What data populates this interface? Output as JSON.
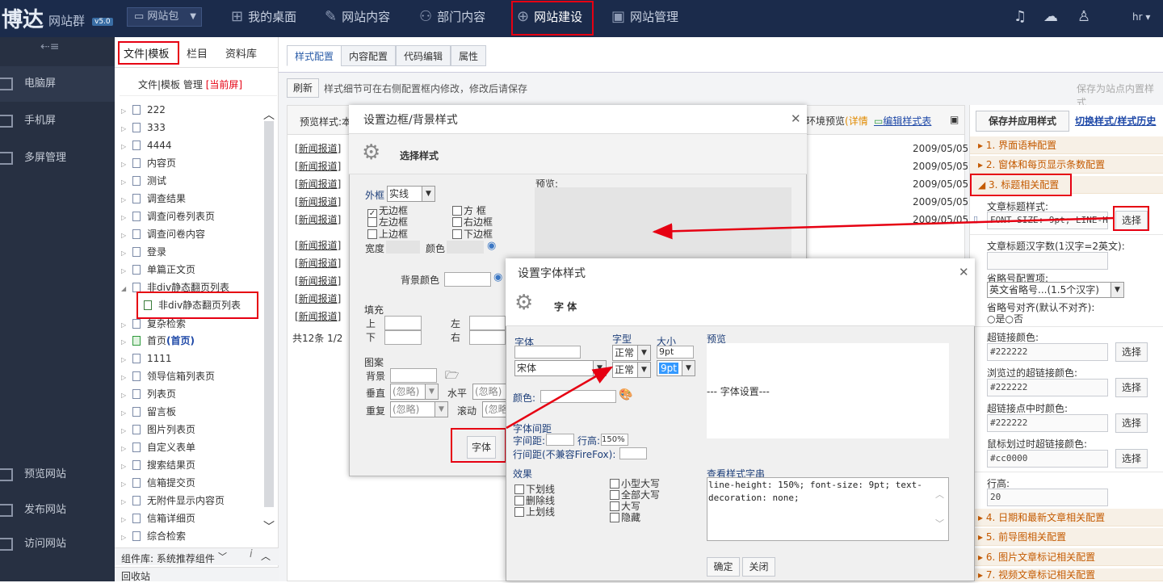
{
  "header": {
    "logo": "博达",
    "logo_sub": "网站群",
    "version": "v5.0",
    "site_select": "网站包",
    "nav": [
      "我的桌面",
      "网站内容",
      "部门内容",
      "网站建设",
      "网站管理"
    ],
    "user": "hr"
  },
  "left_sidebar": {
    "collapse_icon": "menu-collapse-icon",
    "items": [
      "电脑屏",
      "手机屏",
      "多屏管理"
    ],
    "bottom_items": [
      "预览网站",
      "发布网站",
      "访问网站"
    ]
  },
  "file_panel": {
    "tabs": [
      "文件|模板",
      "栏目",
      "资料库"
    ],
    "header": "文件|模板 管理",
    "current": "[当前屏]",
    "items": [
      "222",
      "333",
      "4444",
      "内容页",
      "测试",
      "调查结果",
      "调查问卷列表页",
      "调查问卷内容",
      "登录",
      "单篇正文页",
      "非div静态翻页列表",
      "非div静态翻页列表",
      "复杂检索",
      "首页",
      "(首页)",
      "1111",
      "领导信箱列表页",
      "列表页",
      "留言板",
      "图片列表页",
      "自定义表单",
      "搜索结果页",
      "信箱提交页",
      "无附件显示内容页",
      "信箱详细页",
      "综合检索"
    ],
    "components": "组件库: 系统推荐组件",
    "recycle": "回收站"
  },
  "main": {
    "tabs": [
      "样式配置",
      "内容配置",
      "代码编辑",
      "属性"
    ],
    "refresh": "刷新",
    "tip": "样式细节可在右侧配置框内修改，修改后请保存",
    "save_as": "保存为站点内置样式",
    "preview_label": "预览样式:本",
    "env_preview": "环境预览",
    "detail": "(详情",
    "edit_style": "编辑样式表",
    "news_tag": "[新闻报道]",
    "news_dates": [
      "2009/05/05",
      "2009/05/05",
      "2009/05/05",
      "2009/05/05",
      "2009/05/05"
    ],
    "pager": "共12条  1/2"
  },
  "right_panel": {
    "save_apply": "保存并应用样式",
    "switch": "切换样式/样式历史",
    "sections": [
      "1. 界面语种配置",
      "2. 窗体和每页显示条数配置",
      "3. 标题相关配置",
      "4. 日期和最新文章相关配置",
      "5. 前导图相关配置",
      "6. 图片文章标记相关配置",
      "7. 视频文章标记相关配置"
    ],
    "title_style_label": "文章标题样式:",
    "title_style_value": "FONT-SIZE: 9pt; LINE-HEI",
    "choose": "选择",
    "title_chars_label": "文章标题汉字数(1汉字=2英文):",
    "ellipsis_label": "省略号配置项:",
    "ellipsis_value": "英文省略号...(1.5个汉字)",
    "ellipsis_align_label": "省略号对齐(默认不对齐):",
    "align_yes": "是",
    "align_no": "否",
    "link_color_label": "超链接颜色:",
    "link_color": "#222222",
    "visited_label": "浏览过的超链接颜色:",
    "visited_color": "#222222",
    "active_label": "超链接点中时颜色:",
    "active_color": "#222222",
    "hover_label": "鼠标划过时超链接颜色:",
    "hover_color": "#cc0000",
    "line_height_label": "行高:",
    "line_height": "20"
  },
  "modal_border": {
    "title": "设置边框/背景样式",
    "subtitle": "选择样式",
    "outer_label": "外框",
    "outer_value": "实线",
    "borders": [
      "无边框",
      "方  框",
      "左边框",
      "右边框",
      "上边框",
      "下边框"
    ],
    "width_label": "宽度",
    "color_label": "颜色",
    "bg_color_label": "背景颜色",
    "padding_label": "填充",
    "pad_top": "上",
    "pad_left": "左",
    "pad_bottom": "下",
    "pad_right": "右",
    "image_label": "图案",
    "bg_label": "背景",
    "vertical_label": "垂直",
    "horizontal_label": "水平",
    "repeat_label": "重复",
    "scroll_label": "滚动",
    "ignore": "(忽略)",
    "preview_label": "预览:",
    "font_btn": "字体"
  },
  "modal_font": {
    "title": "设置字体样式",
    "subtitle": "字 体",
    "font_label": "字体",
    "font_value": "宋体",
    "style_label": "字型",
    "style_value1": "正常",
    "style_value2": "正常",
    "size_label": "大小",
    "size_value1": "9pt",
    "size_value2": "9pt",
    "color_label": "颜色:",
    "spacing_title": "字体间距",
    "letter_spacing": "字间距:",
    "line_height": "行高:",
    "line_height_value": "150%",
    "row_spacing": "行间距(不兼容FireFox):",
    "effects_title": "效果",
    "effects_left": [
      "下划线",
      "删除线",
      "上划线"
    ],
    "effects_right": [
      "小型大写",
      "全部大写",
      "大写",
      "隐藏"
    ],
    "preview_label": "预览",
    "preview_text": "--- 字体设置---",
    "css_label": "查看样式字串",
    "css_value": "line-height: 150%; font-size: 9pt; text-decoration: none;",
    "ok": "确定",
    "close": "关闭"
  },
  "colors": {
    "topbar": "#1b2b4b",
    "sidebar": "#273042",
    "highlight": "#e60012",
    "accent": "#2a5ca8"
  }
}
